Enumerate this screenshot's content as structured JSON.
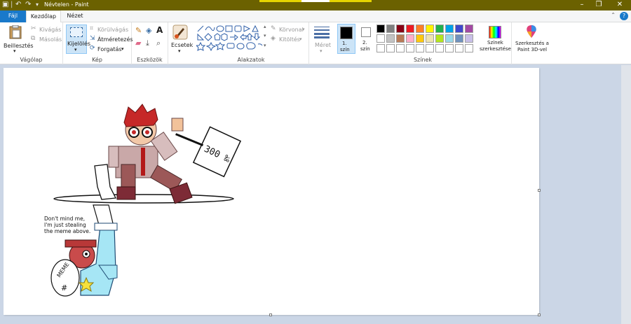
{
  "window": {
    "title": "Névtelen - Paint"
  },
  "tabs": {
    "file": "Fájl",
    "home": "Kezdőlap",
    "view": "Nézet"
  },
  "clipboard": {
    "paste": "Beillesztés",
    "cut": "Kivágás",
    "copy": "Másolás",
    "group": "Vágólap"
  },
  "image": {
    "select": "Kijelölés",
    "crop": "Körülvágás",
    "resize": "Átméretezés",
    "rotate": "Forgatás",
    "group": "Kép"
  },
  "tools": {
    "group": "Eszközök"
  },
  "brushes": {
    "label": "Ecsetek"
  },
  "shapes": {
    "outline": "Körvonal",
    "fill": "Kitöltés",
    "group": "Alakzatok"
  },
  "size": {
    "label": "Méret"
  },
  "colors": {
    "color1": "1. szín",
    "color2": "2. szín",
    "edit": "Színek szerkesztése",
    "group": "Színek",
    "palette": [
      "#000000",
      "#7f7f7f",
      "#880015",
      "#ed1c24",
      "#ff7f27",
      "#fff200",
      "#22b14c",
      "#00a2e8",
      "#3f48cc",
      "#a349a4",
      "#ffffff",
      "#c3c3c3",
      "#b97a57",
      "#ffaec9",
      "#ffc90e",
      "#efe4b0",
      "#b5e61d",
      "#99d9ea",
      "#7092be",
      "#c8bfe7"
    ]
  },
  "paint3d": {
    "label": "Szerkesztés a Paint 3D-vel"
  },
  "drawing": {
    "sign_text": "300 ‰",
    "caption1": "Don't mind me,",
    "caption2": "I'm just stealing",
    "caption3": "the meme above.",
    "bag_text": "MEME",
    "bag_symbol": "#"
  }
}
